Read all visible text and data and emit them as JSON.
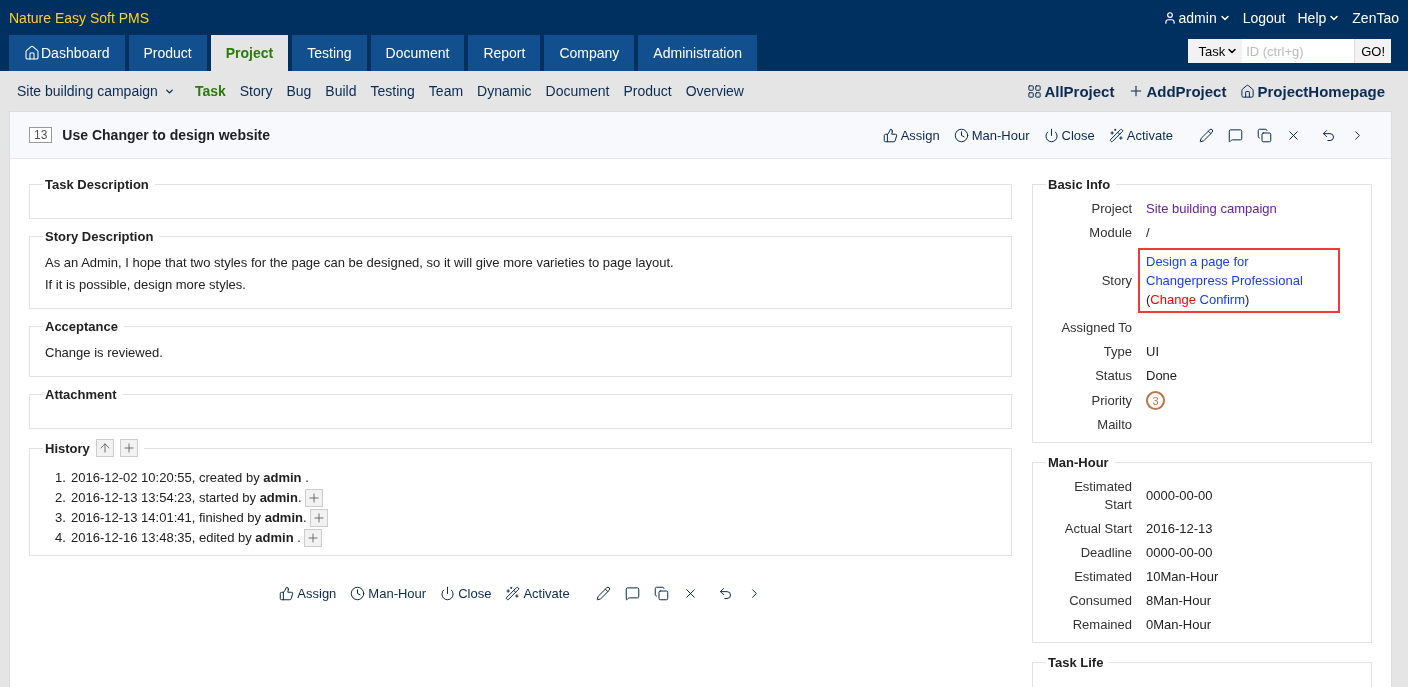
{
  "app": {
    "name": "Nature Easy Soft PMS"
  },
  "user_menu": [
    {
      "label": "admin",
      "kind": "user"
    },
    {
      "label": "Logout",
      "kind": "link"
    },
    {
      "label": "Help",
      "kind": "dropdown"
    },
    {
      "label": "ZenTao",
      "kind": "link"
    }
  ],
  "nav_tabs": [
    {
      "label": "Dashboard",
      "has_icon": true,
      "selected": false
    },
    {
      "label": "Product",
      "has_icon": false,
      "selected": false
    },
    {
      "label": "Project",
      "has_icon": false,
      "selected": true
    },
    {
      "label": "Testing",
      "has_icon": false,
      "selected": false
    },
    {
      "label": "Document",
      "has_icon": false,
      "selected": false
    },
    {
      "label": "Report",
      "has_icon": false,
      "selected": false
    },
    {
      "label": "Company",
      "has_icon": false,
      "selected": false
    },
    {
      "label": "Administration",
      "has_icon": false,
      "selected": false
    }
  ],
  "search": {
    "type": "Task",
    "placeholder": "ID (ctrl+g)",
    "button": "GO!"
  },
  "subnav": {
    "project": "Site building campaign",
    "items": [
      {
        "label": "Task",
        "selected": true
      },
      {
        "label": "Story",
        "selected": false
      },
      {
        "label": "Bug",
        "selected": false
      },
      {
        "label": "Build",
        "selected": false
      },
      {
        "label": "Testing",
        "selected": false
      },
      {
        "label": "Team",
        "selected": false
      },
      {
        "label": "Dynamic",
        "selected": false
      },
      {
        "label": "Document",
        "selected": false
      },
      {
        "label": "Product",
        "selected": false
      },
      {
        "label": "Overview",
        "selected": false
      }
    ],
    "actions": [
      {
        "kind": "grid",
        "label": "AllProject"
      },
      {
        "kind": "add",
        "label": "AddProject"
      },
      {
        "kind": "home",
        "label": "ProjectHomepage"
      }
    ]
  },
  "task": {
    "id": "13",
    "title": "Use Changer to design website"
  },
  "top_actions": [
    {
      "kind": "assign",
      "label": "Assign"
    },
    {
      "kind": "hours",
      "label": "Man-Hour"
    },
    {
      "kind": "close",
      "label": "Close"
    },
    {
      "kind": "activate",
      "label": "Activate"
    },
    {
      "kind": "edit"
    },
    {
      "kind": "comment"
    },
    {
      "kind": "copy"
    },
    {
      "kind": "delete"
    },
    {
      "kind": "back"
    },
    {
      "kind": "next"
    }
  ],
  "sections": [
    {
      "title": "Task Description"
    },
    {
      "title": "Story Description",
      "lines": [
        "As an Admin, I hope that two styles for the page can be designed, so it will give more varieties to page layout.",
        "If it is possible, design more styles."
      ]
    },
    {
      "title": "Acceptance",
      "lines": [
        "Change is reviewed."
      ]
    },
    {
      "title": "Attachment"
    }
  ],
  "history": {
    "title": "History",
    "entries": [
      {
        "number": "1.",
        "text": "2016-12-02 10:20:55, created by **admin** .",
        "expandable": false
      },
      {
        "number": "2.",
        "text": "2016-12-13 13:54:23, started by **admin**.",
        "expandable": true
      },
      {
        "number": "3.",
        "text": "2016-12-13 14:01:41, finished by **admin**.",
        "expandable": true
      },
      {
        "number": "4.",
        "text": "2016-12-16 13:48:35, edited by **admin** .",
        "expandable": true
      }
    ]
  },
  "bottom_actions": [
    {
      "kind": "assign",
      "label": "Assign"
    },
    {
      "kind": "hours",
      "label": "Man-Hour"
    },
    {
      "kind": "close",
      "label": "Close"
    },
    {
      "kind": "activate",
      "label": "Activate"
    },
    {
      "kind": "edit"
    },
    {
      "kind": "comment"
    },
    {
      "kind": "copy"
    },
    {
      "kind": "delete"
    },
    {
      "kind": "back"
    },
    {
      "kind": "next"
    }
  ],
  "basic_info": {
    "title": "Basic Info",
    "rows": [
      {
        "label": "Project",
        "kind": "link",
        "value": "Site building campaign"
      },
      {
        "label": "Module",
        "kind": "text",
        "value": "/"
      },
      {
        "label": "Story",
        "kind": "story",
        "highlighted": true,
        "parts": [
          {
            "kind": "link",
            "text": "Design a page for Changerpress Professional"
          },
          {
            "kind": "plain",
            "text": "("
          },
          {
            "kind": "alert",
            "text": "Change"
          },
          {
            "kind": "link",
            "text": "Confirm"
          },
          {
            "kind": "plain",
            "text": ")"
          }
        ]
      },
      {
        "label": "Assigned To",
        "kind": "text"
      },
      {
        "label": "Type",
        "kind": "text",
        "value": "UI"
      },
      {
        "label": "Status",
        "kind": "text",
        "value": "Done"
      },
      {
        "label": "Priority",
        "kind": "priority",
        "value": "3"
      },
      {
        "label": "Mailto",
        "kind": "text"
      }
    ]
  },
  "man_hour": {
    "title": "Man-Hour",
    "rows": [
      {
        "label": "Estimated Start",
        "value": "0000-00-00"
      },
      {
        "label": "Actual Start",
        "value": "2016-12-13"
      },
      {
        "label": "Deadline",
        "value": "0000-00-00"
      },
      {
        "label": "Estimated",
        "value": "10Man-Hour"
      },
      {
        "label": "Consumed",
        "value": "8Man-Hour"
      },
      {
        "label": "Remained",
        "value": "0Man-Hour"
      }
    ]
  },
  "task_life": {
    "title": "Task Life"
  }
}
